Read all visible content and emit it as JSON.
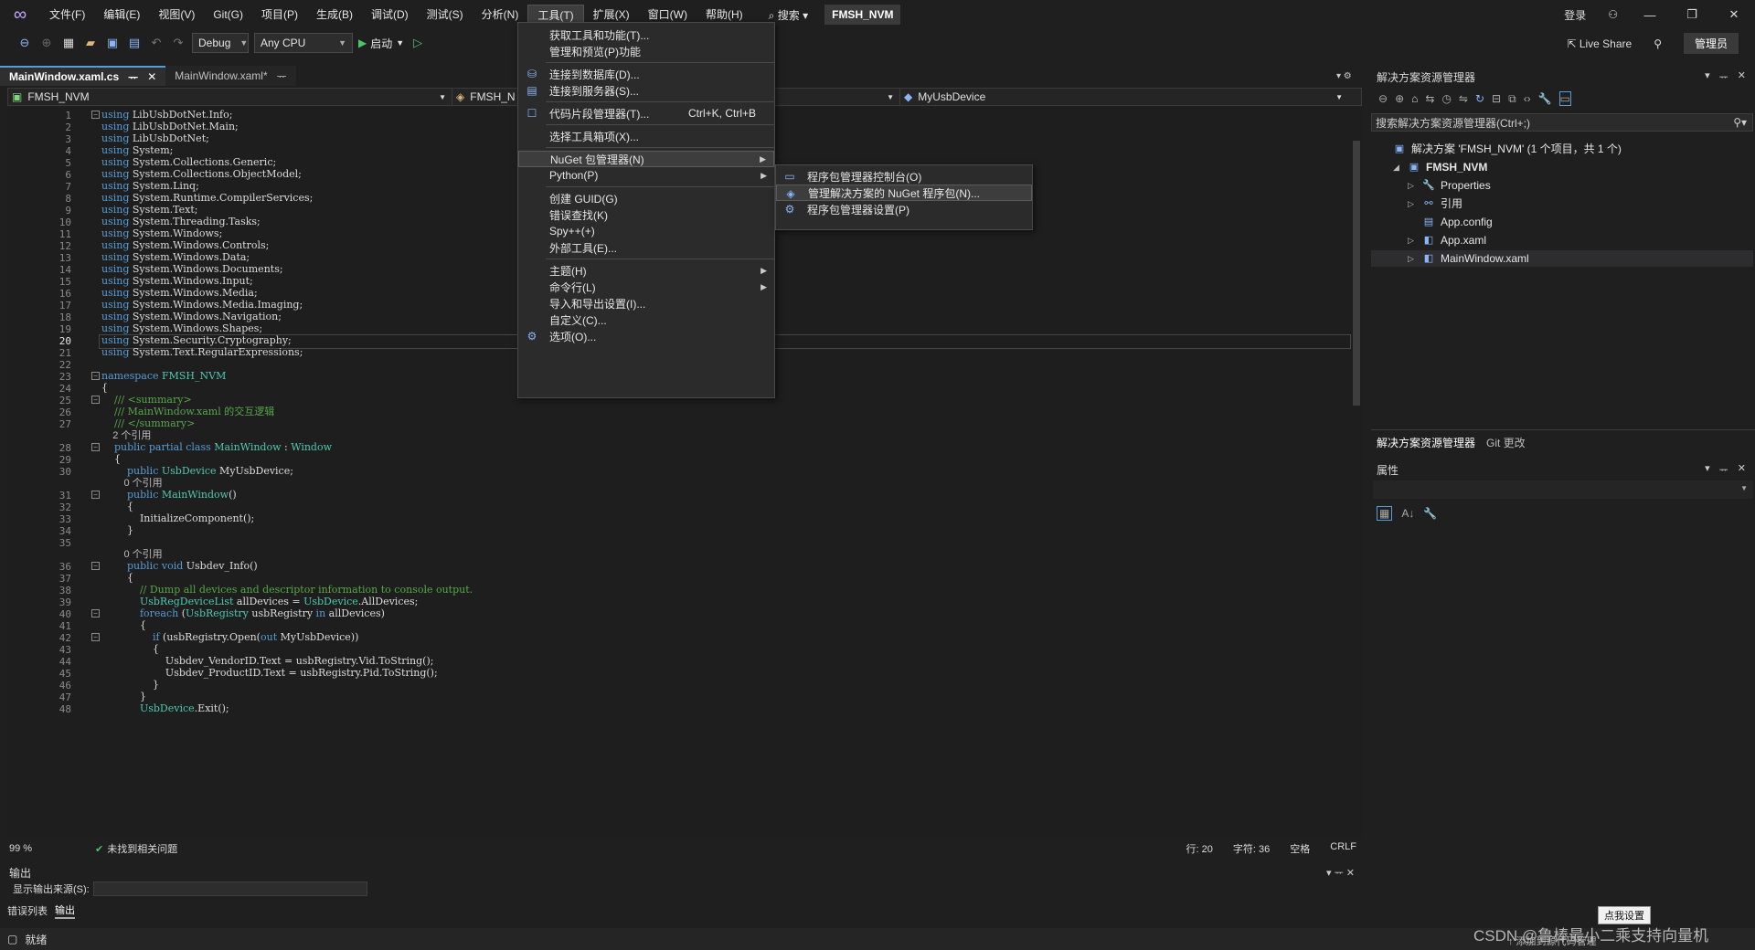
{
  "menubar": {
    "items": [
      "文件(F)",
      "编辑(E)",
      "视图(V)",
      "Git(G)",
      "项目(P)",
      "生成(B)",
      "调试(D)",
      "测试(S)",
      "分析(N)",
      "工具(T)",
      "扩展(X)",
      "窗口(W)",
      "帮助(H)"
    ],
    "search": "搜索",
    "project_name": "FMSH_NVM",
    "login": "登录",
    "window_min": "—",
    "window_max": "❐",
    "window_close": "✕"
  },
  "toolbar": {
    "config": "Debug",
    "platform": "Any CPU",
    "start_label": "启动",
    "live_share": "Live Share",
    "admin": "管理员"
  },
  "tabs": [
    {
      "label": "MainWindow.xaml.cs",
      "pin": "ᅲ",
      "close": "✕"
    },
    {
      "label": "MainWindow.xaml*",
      "pin": "ᅲ"
    }
  ],
  "navbar": {
    "project": "FMSH_NVM",
    "class": "FMSH_N",
    "member": "MyUsbDevice"
  },
  "code": {
    "line_numbers": [
      "1",
      "2",
      "3",
      "4",
      "5",
      "6",
      "7",
      "8",
      "9",
      "10",
      "11",
      "12",
      "13",
      "14",
      "15",
      "16",
      "17",
      "18",
      "19",
      "20",
      "21",
      "22",
      "23",
      "24",
      "25",
      "26",
      "27",
      "",
      "28",
      "29",
      "30",
      "",
      "31",
      "32",
      "33",
      "34",
      "35",
      "",
      "36",
      "37",
      "38",
      "39",
      "40",
      "41",
      "42",
      "43",
      "44",
      "45",
      "46",
      "47",
      "48"
    ],
    "lines": [
      "using LibUsbDotNet.Info;",
      "using LibUsbDotNet.Main;",
      "using LibUsbDotNet;",
      "using System;",
      "using System.Collections.Generic;",
      "using System.Collections.ObjectModel;",
      "using System.Linq;",
      "using System.Runtime.CompilerServices;",
      "using System.Text;",
      "using System.Threading.Tasks;",
      "using System.Windows;",
      "using System.Windows.Controls;",
      "using System.Windows.Data;",
      "using System.Windows.Documents;",
      "using System.Windows.Input;",
      "using System.Windows.Media;",
      "using System.Windows.Media.Imaging;",
      "using System.Windows.Navigation;",
      "using System.Windows.Shapes;",
      "using System.Security.Cryptography;",
      "using System.Text.RegularExpressions;",
      "",
      "namespace FMSH_NVM",
      "{",
      "    /// <summary>",
      "    /// MainWindow.xaml 的交互逻辑",
      "    /// </summary>",
      "    2 个引用",
      "    public partial class MainWindow : Window",
      "    {",
      "        public UsbDevice MyUsbDevice;",
      "        0 个引用",
      "        public MainWindow()",
      "        {",
      "            InitializeComponent();",
      "        }",
      "",
      "        0 个引用",
      "        public void Usbdev_Info()",
      "        {",
      "            // Dump all devices and descriptor information to console output.",
      "            UsbRegDeviceList allDevices = UsbDevice.AllDevices;",
      "            foreach (UsbRegistry usbRegistry in allDevices)",
      "            {",
      "                if (usbRegistry.Open(out MyUsbDevice))",
      "                {",
      "                    Usbdev_VendorID.Text = usbRegistry.Vid.ToString();",
      "                    Usbdev_ProductID.Text = usbRegistry.Pid.ToString();",
      "                }",
      "            }",
      "            UsbDevice.Exit();"
    ]
  },
  "tools_menu": {
    "items": [
      {
        "label": "获取工具和功能(T)...",
        "icon": ""
      },
      {
        "label": "管理和预览(P)功能",
        "icon": ""
      },
      {
        "sep": true
      },
      {
        "label": "连接到数据库(D)...",
        "icon": "database-icon"
      },
      {
        "label": "连接到服务器(S)...",
        "icon": "server-icon"
      },
      {
        "sep": true
      },
      {
        "label": "代码片段管理器(T)...",
        "icon": "checkbox-icon",
        "shortcut": "Ctrl+K, Ctrl+B"
      },
      {
        "sep": true
      },
      {
        "label": "选择工具箱项(X)...",
        "icon": ""
      },
      {
        "sep": true
      },
      {
        "label": "NuGet 包管理器(N)",
        "icon": "",
        "submenu": true,
        "highlight": true
      },
      {
        "label": "Python(P)",
        "icon": "",
        "submenu": true
      },
      {
        "sep": true
      },
      {
        "label": "创建 GUID(G)",
        "icon": ""
      },
      {
        "label": "错误查找(K)",
        "icon": ""
      },
      {
        "label": "Spy++(+)",
        "icon": ""
      },
      {
        "label": "外部工具(E)...",
        "icon": ""
      },
      {
        "sep": true
      },
      {
        "label": "主题(H)",
        "icon": "",
        "submenu": true
      },
      {
        "label": "命令行(L)",
        "icon": "",
        "submenu": true
      },
      {
        "label": "导入和导出设置(I)...",
        "icon": ""
      },
      {
        "label": "自定义(C)...",
        "icon": ""
      },
      {
        "label": "选项(O)...",
        "icon": "gear-icon"
      }
    ]
  },
  "nuget_menu": {
    "items": [
      {
        "label": "程序包管理器控制台(O)",
        "icon": "console-icon"
      },
      {
        "label": "管理解决方案的 NuGet 程序包(N)...",
        "icon": "nuget-icon",
        "highlight": true
      },
      {
        "label": "程序包管理器设置(P)",
        "icon": "gear-icon"
      }
    ]
  },
  "solution_explorer": {
    "title": "解决方案资源管理器",
    "search_placeholder": "搜索解决方案资源管理器(Ctrl+;)",
    "nodes": [
      {
        "label": "解决方案 'FMSH_NVM' (1 个项目，共 1 个)",
        "indent": 0,
        "icon": "solution-icon",
        "tri": ""
      },
      {
        "label": "FMSH_NVM",
        "indent": 1,
        "icon": "csharp-project-icon",
        "tri": "◢",
        "bold": true
      },
      {
        "label": "Properties",
        "indent": 2,
        "icon": "wrench-icon",
        "tri": "▷"
      },
      {
        "label": "引用",
        "indent": 2,
        "icon": "references-icon",
        "tri": "▷"
      },
      {
        "label": "App.config",
        "indent": 2,
        "icon": "config-file-icon",
        "tri": ""
      },
      {
        "label": "App.xaml",
        "indent": 2,
        "icon": "xaml-file-icon",
        "tri": "▷"
      },
      {
        "label": "MainWindow.xaml",
        "indent": 2,
        "icon": "xaml-file-icon",
        "tri": "▷",
        "selected": true
      }
    ],
    "tabs": [
      "解决方案资源管理器",
      "Git 更改"
    ]
  },
  "properties": {
    "title": "属性"
  },
  "editor_status": {
    "zoom": "99 %",
    "issues": "未找到相关问题",
    "line": "行: 20",
    "col": "字符: 36",
    "spaces": "空格",
    "eol": "CRLF"
  },
  "output": {
    "title": "输出",
    "source_label": "显示输出来源(S):",
    "tabs": [
      "错误列表",
      "输出"
    ]
  },
  "statusbar": {
    "ready": "就绪",
    "add_source": "↑ 添加到源代码管理"
  },
  "tooltip": "点我设置",
  "watermark": "CSDN @鲁棒最小二乘支持向量机"
}
